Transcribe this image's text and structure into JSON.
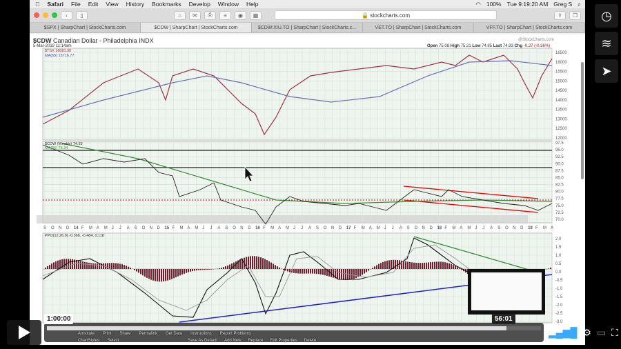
{
  "menubar": {
    "apple": "",
    "app": "Safari",
    "items": [
      "File",
      "Edit",
      "View",
      "History",
      "Bookmarks",
      "Develop",
      "Window",
      "Help"
    ],
    "battery": "100%",
    "clock": "Tue 9:19:20 AM",
    "user": "Greg S"
  },
  "browser": {
    "url": "stockcharts.com",
    "tabs": [
      "$SPX | SharpChart | StockCharts.com",
      "$CDW | SharpChart | StockCharts.com",
      "$CDW:XIU.TO | SharpChart | StockCharts.c...",
      "VET.TO | SharpChart | StockCharts.com",
      "VFF.TO | SharpChart | StockCharts.com"
    ],
    "active_tab": 1
  },
  "chart": {
    "symbol": "$CDW",
    "name": "Canadian Dollar - Philadelphia",
    "exchange": "INDX",
    "date": "5-Mar-2019 11:14am",
    "watermark": "@StockCharts.com",
    "quote": {
      "open_label": "Open",
      "open": "75.08",
      "high_label": "High",
      "high": "75.21",
      "low_label": "Low",
      "low": "74.85",
      "last_label": "Last",
      "last": "74.93",
      "chg_label": "Chg",
      "chg": "-0.27 (-0.36%)"
    },
    "top_legend": [
      "$TSX 16081.30",
      "MA(65) 15716.77"
    ],
    "top_axis": [
      "16500",
      "16000",
      "15500",
      "15000",
      "14500",
      "14000",
      "13500",
      "13000",
      "12500",
      "12000"
    ],
    "mid_legend": [
      "$CDW (Weekly) 74.93",
      "MA(65) 76.34"
    ],
    "mid_axis": [
      "97.5",
      "95.0",
      "92.5",
      "90.0",
      "87.5",
      "85.0",
      "82.5",
      "80.0",
      "77.5",
      "75.0",
      "72.5",
      "70.0"
    ],
    "x_axis": [
      "S",
      "O",
      "N",
      "D",
      "14",
      "F",
      "M",
      "A",
      "M",
      "J",
      "J",
      "A",
      "S",
      "O",
      "N",
      "D",
      "15",
      "F",
      "M",
      "A",
      "M",
      "J",
      "J",
      "A",
      "S",
      "O",
      "N",
      "D",
      "16",
      "F",
      "M",
      "A",
      "M",
      "J",
      "J",
      "A",
      "S",
      "O",
      "N",
      "D",
      "17",
      "F",
      "M",
      "A",
      "M",
      "J",
      "J",
      "A",
      "S",
      "O",
      "N",
      "D",
      "18",
      "F",
      "M",
      "A",
      "M",
      "J",
      "J",
      "A",
      "S",
      "O",
      "N",
      "D",
      "19",
      "F",
      "M",
      "A"
    ],
    "ppo_legend": "PPO(12,26,9) -0.366, -0.484, 0.118",
    "ppo_axis": [
      "2.0",
      "1.5",
      "1.0",
      "0.5",
      "0.0",
      "-0.5",
      "-1.0",
      "-1.5",
      "-2.0",
      "-2.5",
      "-3.0"
    ],
    "bottom_links": [
      "Annotate",
      "Print",
      "Share",
      "Permalink",
      "Get Data",
      "Instructions",
      "Report Problems"
    ],
    "bottom_row": [
      "ChartStyles:",
      "Select",
      "Save As Default",
      "Add New",
      "Replace",
      "Edit Properties",
      "Delete"
    ]
  },
  "video": {
    "hover_time": "1:00:00",
    "current_time": "56:01",
    "progress": 0.93,
    "side_buttons": [
      "clock-icon",
      "layers-icon",
      "send-icon"
    ]
  }
}
